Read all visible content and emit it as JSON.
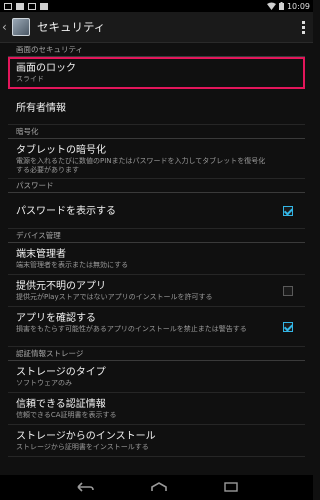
{
  "status_bar": {
    "time": "10:09"
  },
  "action_bar": {
    "title": "セキュリティ"
  },
  "sections": [
    {
      "header": "画面のセキュリティ",
      "items": [
        {
          "title": "画面のロック",
          "summary": "スライド"
        },
        {
          "title": "所有者情報",
          "summary": ""
        }
      ]
    },
    {
      "header": "暗号化",
      "items": [
        {
          "title": "タブレットの暗号化",
          "summary": "電源を入れるたびに数値のPINまたはパスワードを入力してタブレットを復号化する必要があります"
        }
      ]
    },
    {
      "header": "パスワード",
      "items": [
        {
          "title": "パスワードを表示する",
          "summary": "",
          "checked": true
        }
      ]
    },
    {
      "header": "デバイス管理",
      "items": [
        {
          "title": "端末管理者",
          "summary": "端末管理者を表示または無効にする"
        },
        {
          "title": "提供元不明のアプリ",
          "summary": "提供元がPlayストアではないアプリのインストールを許可する",
          "checked": false
        },
        {
          "title": "アプリを確認する",
          "summary": "損害をもたらす可能性があるアプリのインストールを禁止または警告する",
          "checked": true
        }
      ]
    },
    {
      "header": "認証情報ストレージ",
      "items": [
        {
          "title": "ストレージのタイプ",
          "summary": "ソフトウェアのみ"
        },
        {
          "title": "信頼できる認証情報",
          "summary": "信頼できるCA証明書を表示する"
        },
        {
          "title": "ストレージからのインストール",
          "summary": "ストレージから証明書をインストールする"
        }
      ]
    }
  ],
  "colors": {
    "highlight": "#e3165b",
    "accent": "#33b5e5"
  }
}
